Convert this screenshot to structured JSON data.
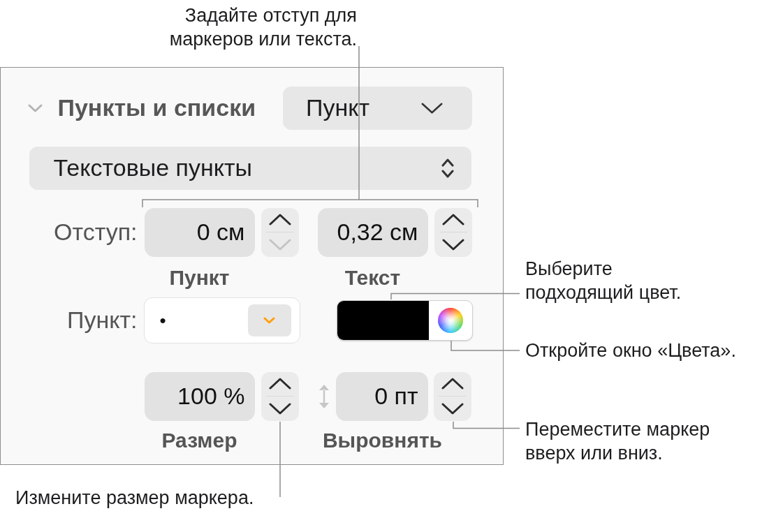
{
  "callouts": [
    {
      "kind": "top",
      "text": "Задайте отступ для\nмаркеров или текста."
    },
    {
      "kind": "right",
      "text": "Выберите\nподходящий цвет."
    },
    {
      "kind": "right",
      "text": "Откройте окно «Цвета»."
    },
    {
      "kind": "right",
      "text": "Переместите маркер\nвверх или вниз."
    },
    {
      "kind": "bottom",
      "text": "Измените размер маркера."
    }
  ],
  "panel": {
    "section": {
      "title": "Пункты и списки",
      "expanded": true
    },
    "bullet_type_popup": {
      "value": "Пункт"
    },
    "list_style_popup": {
      "value": "Текстовые пункты"
    },
    "indent": {
      "label": "Отступ:",
      "fields": [
        {
          "value": "0 см",
          "caption": "Пункт",
          "stepper": {
            "up_disabled": false,
            "down_disabled": true
          }
        },
        {
          "value": "0,32 см",
          "caption": "Текст",
          "stepper": {
            "up_disabled": false,
            "down_disabled": false
          }
        }
      ]
    },
    "bullet": {
      "label": "Пункт:",
      "value": "•",
      "color": "#000000"
    },
    "size": {
      "value": "100 %",
      "caption": "Размер",
      "stepper": {
        "up_disabled": false,
        "down_disabled": false
      }
    },
    "align": {
      "value": "0 пт",
      "caption": "Выровнять",
      "stepper": {
        "up_disabled": false,
        "down_disabled": false
      }
    }
  }
}
